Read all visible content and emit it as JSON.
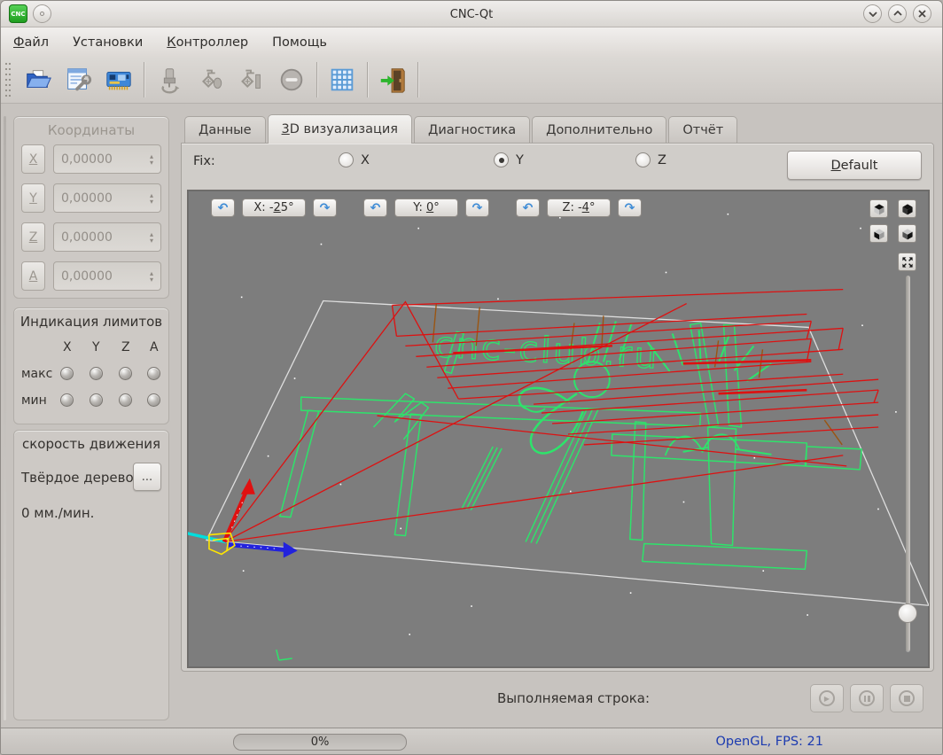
{
  "window": {
    "title": "CNC-Qt",
    "badge": "CNC"
  },
  "menubar": {
    "items": [
      {
        "hot": "Ф",
        "rest": "айл"
      },
      {
        "hot": "",
        "rest": "Установки"
      },
      {
        "hot": "К",
        "rest": "онтроллер"
      },
      {
        "hot": "",
        "rest": "Помощь"
      }
    ]
  },
  "toolbar": {
    "icons": [
      "open-file",
      "program-settings",
      "controller-info",
      "spindle",
      "coolant-mist",
      "coolant-flood",
      "emergency-stop",
      "grid-snap",
      "exit"
    ]
  },
  "sidebar": {
    "coordinates": {
      "title": "Координаты",
      "rows": [
        {
          "axis": "X",
          "value": "0,00000"
        },
        {
          "axis": "Y",
          "value": "0,00000"
        },
        {
          "axis": "Z",
          "value": "0,00000"
        },
        {
          "axis": "A",
          "value": "0,00000"
        }
      ]
    },
    "limits": {
      "title": "Индикация лимитов",
      "columns": [
        "X",
        "Y",
        "Z",
        "A"
      ],
      "row_max": "макс",
      "row_min": "мин"
    },
    "speed": {
      "title": "скорость движения",
      "material": "Твёрдое дерево",
      "browse": "...",
      "feed": "0 мм./мин."
    }
  },
  "tabs": [
    {
      "hot": "",
      "rest": "Данные"
    },
    {
      "hot": "3",
      "rest": "D визуализация"
    },
    {
      "hot": "",
      "rest": "Диагностика"
    },
    {
      "hot": "",
      "rest": "Дополнительно"
    },
    {
      "hot": "",
      "rest": "Отчёт"
    }
  ],
  "fix": {
    "label": "Fix:",
    "options": [
      {
        "label": "X",
        "selected": false
      },
      {
        "label": "Y",
        "selected": true
      },
      {
        "label": "Z",
        "selected": false
      }
    ],
    "default_button": {
      "hot": "D",
      "rest": "efault"
    }
  },
  "viewport": {
    "rotation": {
      "x": {
        "pre": "X: -",
        "hot": "2",
        "post": "5°"
      },
      "y": {
        "pre": "Y: ",
        "hot": "0",
        "post": "°"
      },
      "z": {
        "pre": "Z: -",
        "hot": "4",
        "post": "°"
      }
    },
    "watermark": "cnc-club.ru",
    "view_buttons": [
      "iso-top-view",
      "iso-dark-view",
      "left-face-view",
      "front-face-view",
      "fit-to-view"
    ]
  },
  "bottom": {
    "label": "Выполняемая строка:"
  },
  "statusbar": {
    "progress": "0%",
    "renderer": "OpenGL, FPS: 21"
  },
  "colors": {
    "path_green": "#2ee36b",
    "rapid_red": "#dd1111",
    "axis_x_blue": "#2222dd",
    "axis_z_red": "#e01010",
    "axis_cyan": "#00dede",
    "marker_yellow": "#ffe600",
    "viewport_bg": "#7d7d7d",
    "fps_text": "#1c3bb0",
    "rotate_arrow_blue": "#4596e0"
  }
}
